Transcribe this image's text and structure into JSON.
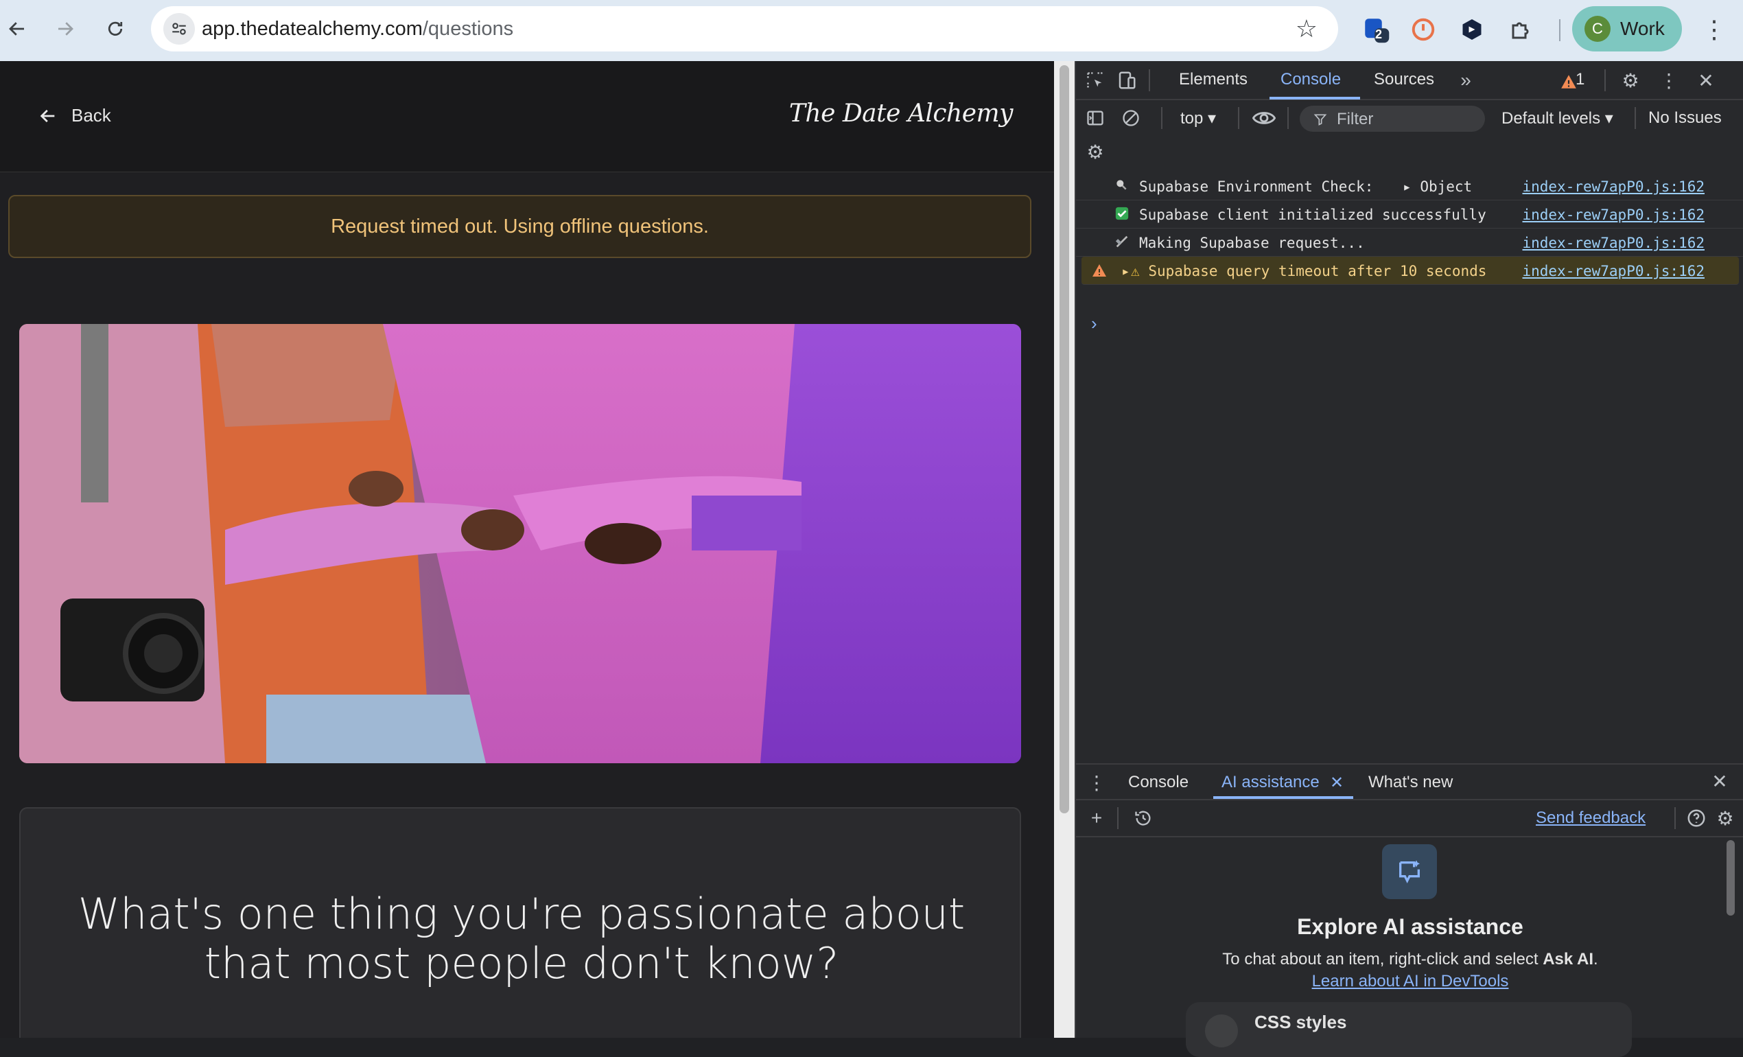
{
  "browser": {
    "url_host": "app.thedatealchemy.com",
    "url_path": "/questions",
    "extension_badge": "2",
    "profile_initial": "C",
    "profile_label": "Work"
  },
  "page": {
    "back_label": "Back",
    "brand": "The Date Alchemy",
    "alert": "Request timed out. Using offline questions.",
    "question": "What's one thing you're passionate about that most people don't know?",
    "colors": {
      "alert_text": "#f0c37a",
      "alert_bg": "#2f281b"
    }
  },
  "devtools": {
    "tabs": [
      "Elements",
      "Console",
      "Sources"
    ],
    "active_tab": "Console",
    "warning_count": "1",
    "context": "top",
    "filter_placeholder": "Filter",
    "levels": "Default levels",
    "issues": "No Issues",
    "logs": [
      {
        "icon": "search-icon",
        "text": "Supabase Environment Check:",
        "extra": "Object",
        "source": "index-rew7apP0.js:162"
      },
      {
        "icon": "check-icon",
        "text": "Supabase client initialized successfully",
        "source": "index-rew7apP0.js:162"
      },
      {
        "icon": "satellite-icon",
        "text": "Making Supabase request...",
        "source": "index-rew7apP0.js:162"
      },
      {
        "icon": "warning-icon",
        "text": "Supabase query timeout after 10 seconds",
        "source": "index-rew7apP0.js:162",
        "level": "warning"
      }
    ],
    "drawer": {
      "tabs": [
        "Console",
        "AI assistance",
        "What's new"
      ],
      "active_tab": "AI assistance",
      "send_feedback": "Send feedback",
      "ai_title": "Explore AI assistance",
      "ai_desc_prefix": "To chat about an item, right-click and select",
      "ai_desc_bold": "Ask AI",
      "ai_desc_suffix": ".",
      "ai_link": "Learn about AI in DevTools",
      "card_label": "CSS styles"
    }
  }
}
